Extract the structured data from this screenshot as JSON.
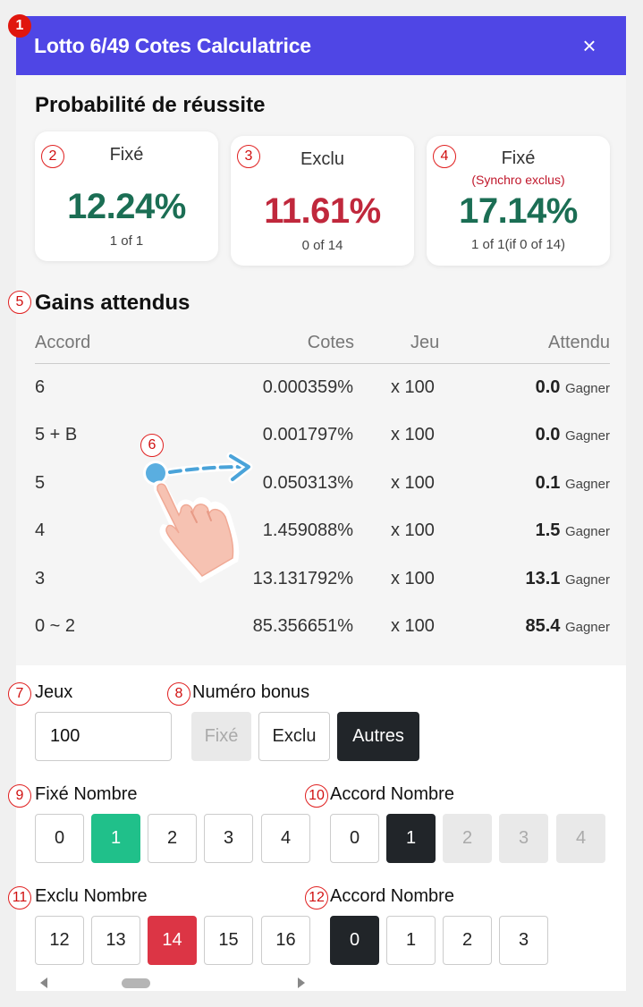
{
  "header": {
    "title": "Lotto 6/49 Cotes Calculatrice",
    "close_icon": "×"
  },
  "badges": [
    "1",
    "2",
    "3",
    "4",
    "5",
    "6",
    "7",
    "8",
    "9",
    "10",
    "11",
    "12"
  ],
  "probability": {
    "title": "Probabilité de réussite",
    "cards": [
      {
        "label": "Fixé",
        "sub": "",
        "value": "12.24%",
        "count": "1 of 1"
      },
      {
        "label": "Exclu",
        "sub": "",
        "value": "11.61%",
        "count": "0 of 14"
      },
      {
        "label": "Fixé",
        "sub": "(Synchro exclus)",
        "value": "17.14%",
        "count": "1 of 1(if 0 of 14)"
      }
    ]
  },
  "gains": {
    "title": "Gains attendus",
    "columns": [
      "Accord",
      "Cotes",
      "Jeu",
      "Attendu"
    ],
    "rows": [
      {
        "accord": "6",
        "odds": "0.000359%",
        "game": "x 100",
        "exp": "0.0",
        "unit": "Gagner"
      },
      {
        "accord": "5 + B",
        "odds": "0.001797%",
        "game": "x 100",
        "exp": "0.0",
        "unit": "Gagner"
      },
      {
        "accord": "5",
        "odds": "0.050313%",
        "game": "x 100",
        "exp": "0.1",
        "unit": "Gagner"
      },
      {
        "accord": "4",
        "odds": "1.459088%",
        "game": "x 100",
        "exp": "1.5",
        "unit": "Gagner"
      },
      {
        "accord": "3",
        "odds": "13.131792%",
        "game": "x 100",
        "exp": "13.1",
        "unit": "Gagner"
      },
      {
        "accord": "0 ~ 2",
        "odds": "85.356651%",
        "game": "x 100",
        "exp": "85.4",
        "unit": "Gagner"
      }
    ]
  },
  "controls": {
    "games_label": "Jeux",
    "games_value": "100",
    "bonus_label": "Numéro bonus",
    "bonus_options": [
      "Fixé",
      "Exclu",
      "Autres"
    ],
    "bonus_selected": "Autres",
    "fixed_label": "Fixé Nombre",
    "fixed_options": [
      "0",
      "1",
      "2",
      "3",
      "4"
    ],
    "fixed_selected": "1",
    "accord1_label": "Accord Nombre",
    "accord1_options": [
      "0",
      "1",
      "2",
      "3",
      "4"
    ],
    "accord1_selected": "1",
    "excluded_label": "Exclu Nombre",
    "excluded_options": [
      "12",
      "13",
      "14",
      "15",
      "16"
    ],
    "excluded_selected": "14",
    "accord2_label": "Accord Nombre",
    "accord2_options": [
      "0",
      "1",
      "2",
      "3"
    ],
    "accord2_selected": "0"
  },
  "colors": {
    "header": "#4f46e5",
    "green": "#1b6e54",
    "red": "#c0283c",
    "selected_green": "#20c08a",
    "selected_red": "#dc3545",
    "dark": "#212529"
  },
  "icons": {
    "close": "close-icon",
    "hand": "swipe-hand-icon",
    "scroll_left": "scroll-left-arrow-icon",
    "scroll_right": "scroll-right-arrow-icon"
  }
}
